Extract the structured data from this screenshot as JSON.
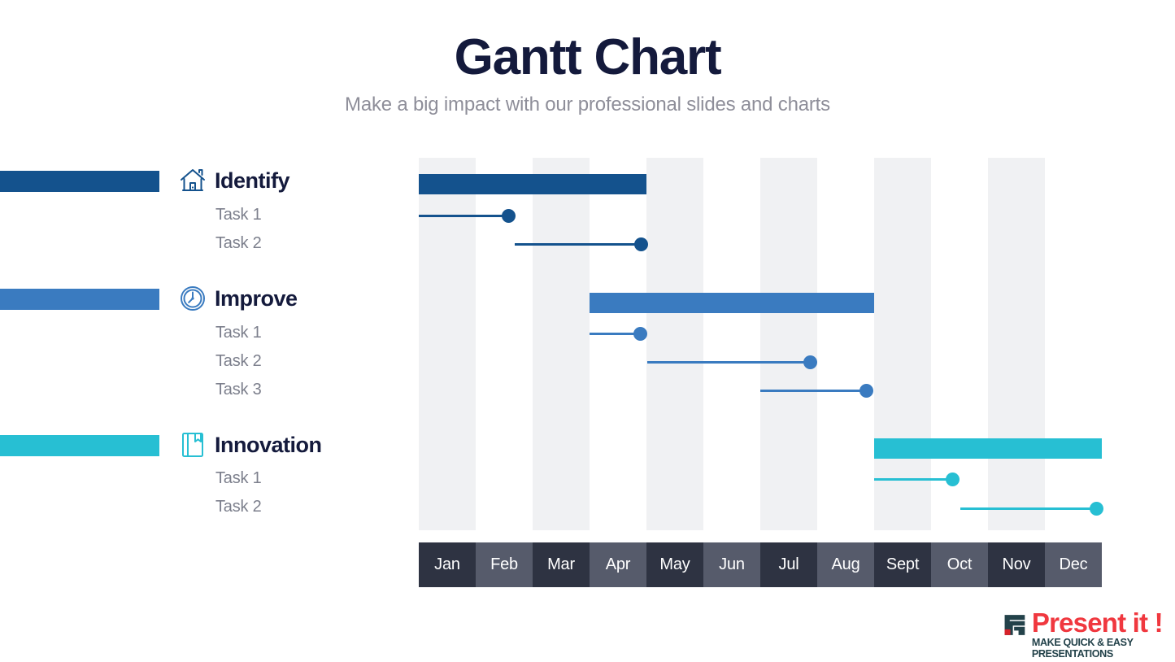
{
  "header": {
    "title": "Gantt Chart",
    "subtitle": "Make a big impact with our professional slides and charts"
  },
  "colors": {
    "title": "#141a3c",
    "subtitle": "#8e8e99",
    "identify": "#14528d",
    "improve": "#3a7bc0",
    "innovation": "#27bfd3",
    "band": "#f0f1f3",
    "month_dark": "#2e3342",
    "month_light": "#565b6b",
    "logo_red": "#f0383f",
    "logo_teal": "#23424a"
  },
  "legend": {
    "groups": [
      {
        "title": "Identify",
        "icon": "house-icon",
        "color": "#14528d",
        "tasks": [
          "Task 1",
          "Task 2"
        ]
      },
      {
        "title": "Improve",
        "icon": "clock-icon",
        "color": "#3a7bc0",
        "tasks": [
          "Task 1",
          "Task 2",
          "Task 3"
        ]
      },
      {
        "title": "Innovation",
        "icon": "book-icon",
        "color": "#27bfd3",
        "tasks": [
          "Task 1",
          "Task 2"
        ]
      }
    ]
  },
  "chart_data": {
    "type": "bar",
    "chart_kind": "gantt",
    "title": "Gantt Chart",
    "xlabel": "",
    "ylabel": "",
    "grid": "vertical-bands-on-odd-months",
    "legend_position": "left",
    "categories": [
      "Jan",
      "Feb",
      "Mar",
      "Apr",
      "May",
      "Jun",
      "Jul",
      "Aug",
      "Sept",
      "Oct",
      "Nov",
      "Dec"
    ],
    "x_axis_months": [
      {
        "label": "Jan",
        "shade": "dark"
      },
      {
        "label": "Feb",
        "shade": "light"
      },
      {
        "label": "Mar",
        "shade": "dark"
      },
      {
        "label": "Apr",
        "shade": "light"
      },
      {
        "label": "May",
        "shade": "dark"
      },
      {
        "label": "Jun",
        "shade": "light"
      },
      {
        "label": "Jul",
        "shade": "dark"
      },
      {
        "label": "Aug",
        "shade": "light"
      },
      {
        "label": "Sept",
        "shade": "dark"
      },
      {
        "label": "Oct",
        "shade": "light"
      },
      {
        "label": "Nov",
        "shade": "dark"
      },
      {
        "label": "Dec",
        "shade": "light"
      }
    ],
    "xlim": [
      0,
      12
    ],
    "series": [
      {
        "name": "Identify",
        "color": "#14528d",
        "kind": "group-bar",
        "start_month": 0.0,
        "end_month": 4.0,
        "row": 0
      },
      {
        "name": "Identify – Task 1",
        "color": "#14528d",
        "kind": "milestone-line",
        "start_month": 0.0,
        "end_month": 1.58,
        "row": 1
      },
      {
        "name": "Identify – Task 2",
        "color": "#14528d",
        "kind": "milestone-line",
        "start_month": 1.68,
        "end_month": 3.9,
        "row": 2
      },
      {
        "name": "Improve",
        "color": "#3a7bc0",
        "kind": "group-bar",
        "start_month": 3.0,
        "end_month": 8.0,
        "row": 3
      },
      {
        "name": "Improve – Task 1",
        "color": "#3a7bc0",
        "kind": "milestone-line",
        "start_month": 3.0,
        "end_month": 3.89,
        "row": 4
      },
      {
        "name": "Improve – Task 2",
        "color": "#3a7bc0",
        "kind": "milestone-line",
        "start_month": 4.02,
        "end_month": 6.88,
        "row": 5
      },
      {
        "name": "Improve – Task 3",
        "color": "#3a7bc0",
        "kind": "milestone-line",
        "start_month": 6.0,
        "end_month": 7.87,
        "row": 6
      },
      {
        "name": "Innovation",
        "color": "#27bfd3",
        "kind": "group-bar",
        "start_month": 8.0,
        "end_month": 12.0,
        "row": 7
      },
      {
        "name": "Innovation – Task 1",
        "color": "#27bfd3",
        "kind": "milestone-line",
        "start_month": 8.0,
        "end_month": 9.38,
        "row": 8
      },
      {
        "name": "Innovation – Task 2",
        "color": "#27bfd3",
        "kind": "milestone-line",
        "start_month": 9.52,
        "end_month": 11.91,
        "row": 9
      }
    ]
  },
  "logo": {
    "name": "Present it !",
    "tagline": "MAKE QUICK & EASY PRESENTATIONS"
  }
}
